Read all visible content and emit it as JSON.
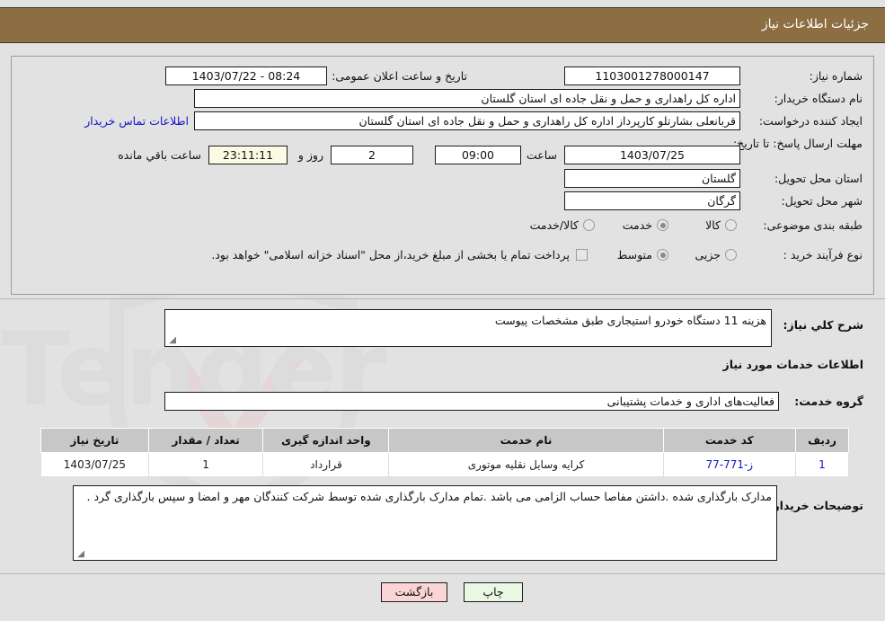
{
  "header": {
    "title": "جزئیات اطلاعات نیاز",
    "bg_color": "#8d6e43",
    "text_color": "#ffffff"
  },
  "top_form": {
    "need_number": {
      "label": "شماره نیاز:",
      "value": "1103001278000147"
    },
    "public_announce": {
      "label": "تاریخ و ساعت اعلان عمومی:",
      "value": "08:24 - 1403/07/22"
    },
    "buyer_org": {
      "label": "نام دستگاه خریدار:",
      "value": "اداره کل راهداری و حمل و نقل جاده ای استان گلستان"
    },
    "request_creator": {
      "label": "ایجاد کننده درخواست:",
      "value": "قربانعلی بشارتلو کارپرداز اداره کل راهداری و حمل و نقل جاده ای استان گلستان"
    },
    "buyer_contact_link": "اطلاعات تماس خریدار",
    "deadline": {
      "label": "مهلت ارسال پاسخ: تا تاریخ:",
      "date": "1403/07/25",
      "time_label": "ساعت",
      "time": "09:00",
      "days_value": "2",
      "days_label": "روز و",
      "countdown": "23:11:11",
      "countdown_suffix": "ساعت باقي مانده"
    },
    "delivery_province": {
      "label": "استان محل تحویل:",
      "value": "گلستان"
    },
    "delivery_city": {
      "label": "شهر محل تحویل:",
      "value": "گرگان"
    },
    "category": {
      "label": "طبقه بندی موضوعی:",
      "options": [
        "کالا",
        "خدمت",
        "کالا/خدمت"
      ],
      "selected": "خدمت"
    },
    "purchase_type": {
      "label": "نوع فرآیند خرید :",
      "options": [
        "جزیی",
        "متوسط"
      ],
      "selected": "متوسط"
    },
    "treasury_note": {
      "text": "پرداخت تمام یا بخشی از مبلغ خرید،از محل \"اسناد خزانه اسلامی\" خواهد بود.",
      "checked": false
    }
  },
  "need_description": {
    "label": "شرح کلي نياز:",
    "value": "هزینه 11 دستگاه خودرو استیجاری طبق مشخصات پیوست"
  },
  "services_section": {
    "heading": "اطلاعات خدمات مورد نیاز",
    "service_group": {
      "label": "گروه خدمت:",
      "value": "فعالیت‌های اداری و خدمات پشتیبانی"
    },
    "table": {
      "columns": [
        "ردیف",
        "کد خدمت",
        "نام خدمت",
        "واحد اندازه گیری",
        "تعداد / مقدار",
        "تاریخ نیاز"
      ],
      "rows": [
        {
          "radif": "1",
          "code": "ز-771-77",
          "name": "کرایه وسایل نقلیه موتوری",
          "unit": "قرارداد",
          "qty": "1",
          "need_date": "1403/07/25"
        }
      ]
    }
  },
  "buyer_notes": {
    "label": "توضیحات خریدار:",
    "value": "مدارک بارگذاری شده .داشتن مفاصا حساب الزامی می باشد .تمام مدارک بارگذاری شده توسط شرکت کنندگان مهر و امضا و سپس بارگذاری گرد ."
  },
  "footer": {
    "print_label": "چاپ",
    "back_label": "بازگشت"
  },
  "watermark": {
    "text": "AnaTender.net"
  }
}
